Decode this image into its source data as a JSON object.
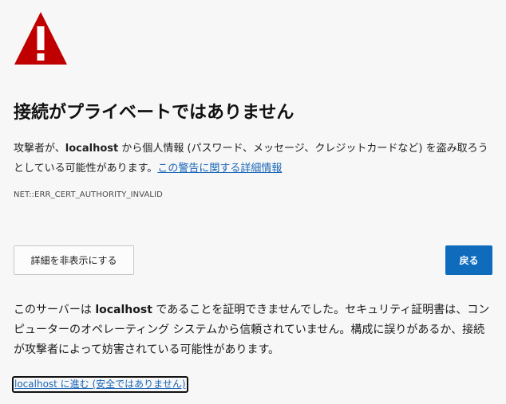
{
  "icon": {
    "name": "warning-triangle-icon",
    "color": "#c00000"
  },
  "title": "接続がプライベートではありません",
  "description": {
    "prefix": "攻撃者が、",
    "host": "localhost",
    "suffix": " から個人情報 (パスワード、メッセージ、クレジットカードなど) を盗み取ろうとしている可能性があります。",
    "link": "この警告に関する詳細情報"
  },
  "error_code": "NET::ERR_CERT_AUTHORITY_INVALID",
  "buttons": {
    "details": "詳細を非表示にする",
    "back": "戻る",
    "back_color": "#0f6cbd"
  },
  "detail": {
    "prefix": "このサーバーは ",
    "host": "localhost",
    "suffix": " であることを証明できませんでした。セキュリティ証明書は、コンピューターのオペレーティング システムから信頼されていません。構成に誤りがあるか、接続が攻撃者によって妨害されている可能性があります。"
  },
  "proceed_link": "localhost に進む (安全ではありません)"
}
